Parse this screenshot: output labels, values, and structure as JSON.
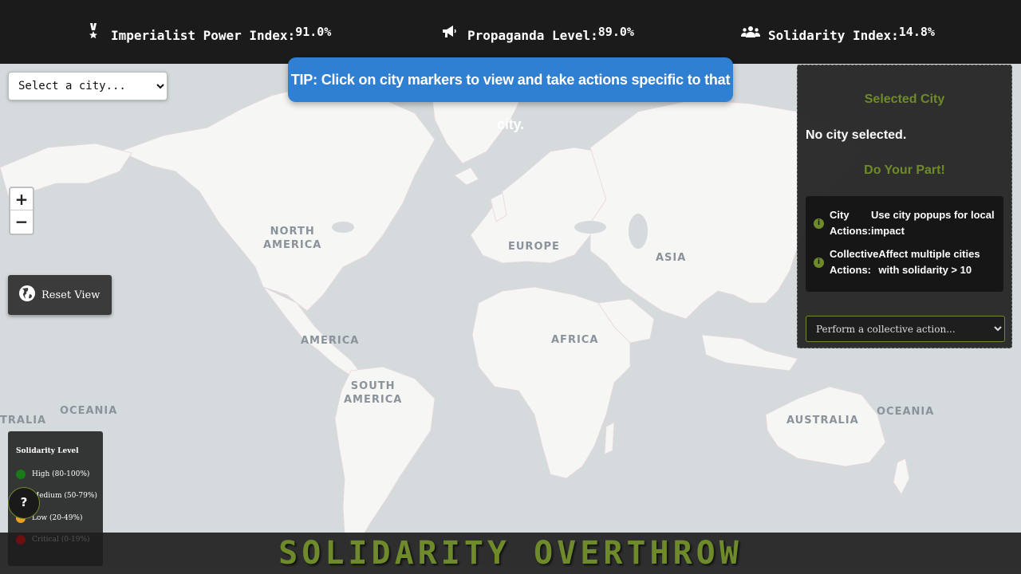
{
  "stats": {
    "imperialist": {
      "icon": "medal-icon",
      "label": "Imperialist Power Index:",
      "value": "91.0%"
    },
    "propaganda": {
      "icon": "megaphone-icon",
      "label": "Propaganda Level:",
      "value": "89.0%"
    },
    "solidarity": {
      "icon": "people-icon",
      "label": "Solidarity Index:",
      "value": "14.8%"
    }
  },
  "city_select": {
    "selected": "Select a city..."
  },
  "tip": "TIP: Click on city markers to view and take actions specific to that city.",
  "zoom": {
    "in": "+",
    "out": "−"
  },
  "reset": {
    "icon": "globe-icon",
    "label": "Reset View"
  },
  "map_labels": {
    "north_america": "NORTH\nAMERICA",
    "america": "AMERICA",
    "south_america": "SOUTH\nAMERICA",
    "europe": "EUROPE",
    "africa": "AFRICA",
    "asia": "ASIA",
    "australia": "AUSTRALIA",
    "oceania_left": "OCEANIA",
    "oceania_right": "OCEANIA",
    "australia_edge": "TRALIA"
  },
  "panel": {
    "selected_title": "Selected City",
    "no_city": "No city selected.",
    "do_your_part": "Do Your Part!",
    "actions": [
      {
        "key": "City Actions:",
        "value": "Use city popups for local impact"
      },
      {
        "key": "Collective Actions:",
        "value": "Affect multiple cities with solidarity > 10"
      }
    ],
    "collective_select": "Perform a collective action..."
  },
  "legend": {
    "title": "Solidarity Level",
    "items": [
      {
        "label": "High (80-100%)",
        "color": "#1a7a1a"
      },
      {
        "label": "Medium (50-79%)",
        "color": "#d8c21a"
      },
      {
        "label": "Low (20-49%)",
        "color": "#f0a020"
      },
      {
        "label": "Critical (0-19%)",
        "color": "#6b0f0f"
      }
    ]
  },
  "help": "?",
  "footer_title": "SOLIDARITY OVERTHROW",
  "colors": {
    "accent": "#6e8a2a",
    "tip": "#2f7fd3",
    "topbar": "#1b1b1b"
  }
}
